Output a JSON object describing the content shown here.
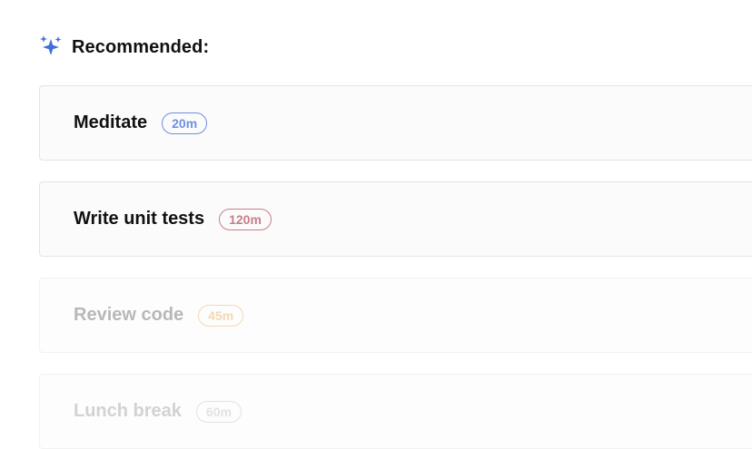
{
  "header": {
    "icon": "sparkles-icon",
    "title": "Recommended:",
    "icon_color": "#3f6fd9"
  },
  "tasks": [
    {
      "title": "Meditate",
      "duration": "20m",
      "badge_color": "#6f8fe0",
      "title_color": "#111111",
      "faded": false
    },
    {
      "title": "Write unit tests",
      "duration": "120m",
      "badge_color": "#c48088",
      "title_color": "#111111",
      "faded": false
    },
    {
      "title": "Review code",
      "duration": "45m",
      "badge_color": "#f4d8b0",
      "title_color": "#b8b8b8",
      "faded": true
    },
    {
      "title": "Lunch break",
      "duration": "60m",
      "badge_color": "#e2e2e2",
      "title_color": "#d2d2d2",
      "faded": true
    }
  ]
}
